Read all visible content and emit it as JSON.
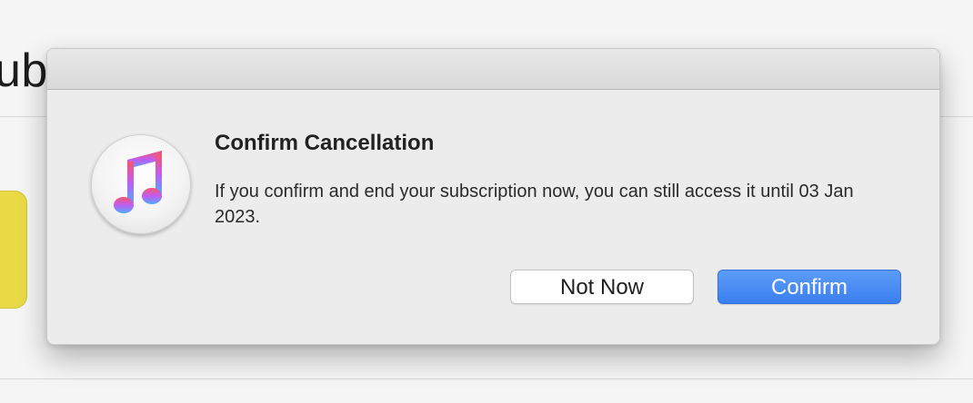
{
  "background": {
    "title_fragment": "ub",
    "accent_card_color": "#e9da45"
  },
  "dialog": {
    "icon": "apple-music-icon",
    "heading": "Confirm Cancellation",
    "message": "If you confirm and end your subscription now, you can still access it until 03 Jan 2023.",
    "buttons": {
      "secondary_label": "Not Now",
      "primary_label": "Confirm"
    },
    "colors": {
      "primary_button": "#3b7ff0",
      "icon_gradient_top": "#f5576c",
      "icon_gradient_bottom": "#4facfe"
    }
  }
}
